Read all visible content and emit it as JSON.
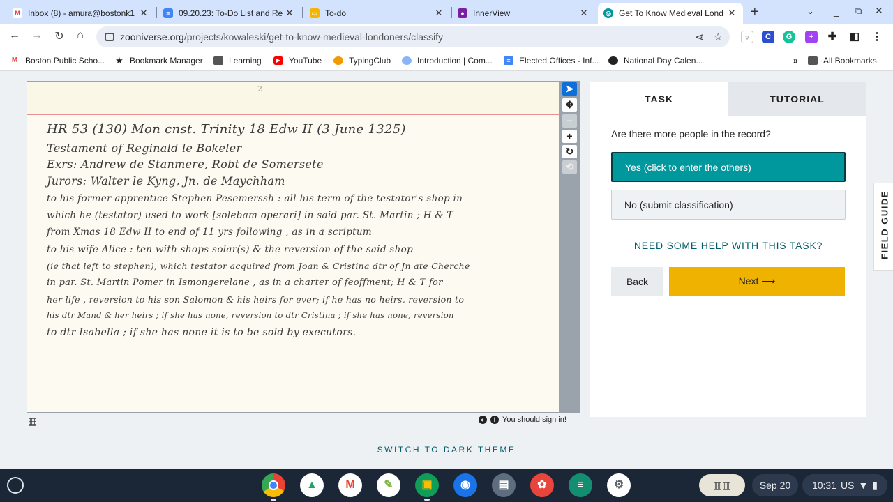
{
  "tabs": [
    {
      "title": "Inbox (8) - amura@bostonk1",
      "icon": "gmail-icon",
      "color": "#ea4335"
    },
    {
      "title": "09.20.23: To-Do List and Re",
      "icon": "docs-icon",
      "color": "#4285f4"
    },
    {
      "title": "To-do",
      "icon": "slides-icon",
      "color": "#f4b400"
    },
    {
      "title": "InnerView",
      "icon": "innerview-icon",
      "color": "#7b1fa2"
    },
    {
      "title": "Get To Know Medieval Lond",
      "icon": "zooniverse-icon",
      "color": "#00979d"
    }
  ],
  "new_tab": "+",
  "address": {
    "host": "zooniverse.org",
    "path": "/projects/kowaleski/get-to-know-medieval-londoners/classify"
  },
  "bookmarks": [
    {
      "label": "Boston Public Scho...",
      "icon": "gmail-icon",
      "color": "#ea4335"
    },
    {
      "label": "Bookmark Manager",
      "icon": "star-icon",
      "color": "#222"
    },
    {
      "label": "Learning",
      "icon": "folder-icon",
      "color": "#555"
    },
    {
      "label": "YouTube",
      "icon": "youtube-icon",
      "color": "#ff0000"
    },
    {
      "label": "TypingClub",
      "icon": "typingclub-icon",
      "color": "#f29900"
    },
    {
      "label": "Introduction | Com...",
      "icon": "globe-icon",
      "color": "#8ab4f8"
    },
    {
      "label": "Elected Offices - Inf...",
      "icon": "docs-icon",
      "color": "#4285f4"
    },
    {
      "label": "National Day Calen...",
      "icon": "globe-icon",
      "color": "#222"
    }
  ],
  "bookmarks_overflow": "»",
  "all_bookmarks": "All Bookmarks",
  "document": {
    "page_mark": "2",
    "lines": [
      "HR 53 (130)    Mon   cnst.  Trinity   18 Edw II    (3 June 1325)",
      "Testament  of   Reginald  le  Bokeler",
      "Exrs:  Andrew  de  Stanmere,  Robt de  Somersete",
      "Jurors:  Walter  le  Kyng,  Jn. de  Maychham",
      "to  his former apprentice  Stephen  Pesemerssh :  all  his  term  of  the  testator's  shop  in",
      "which  he  (testator)  used  to  work  [solebam operari]  in  said  par.  St. Martin ;  H & T",
      "from  Xmas  18 Edw II  to  end  of  11 yrs  following ,   as  in   a  scriptum",
      "to  his  wife  Alice :   ten  with  shops   solar(s)   &  the  reversion  of  the  said  shop",
      "(ie that left to stephen),  which  testator  acquired  from  Joan  &  Cristina  dtr of  Jn ate  Cherche",
      "in  par.  St. Martin  Pomer    in   Ismongerelane ,  as  in  a  charter  of  feoffment;  H & T  for",
      "her  life ,  reversion  to  his  son   Salomon   &  his heirs  for  ever;  if  he has no heirs,  reversion to",
      "his  dtr   Mand  &  her  heirs ;  if she  has  none,  reversion  to   dtr   Cristina ;  if  she  has  none,  reversion",
      "to  dtr  Isabella ;    if  she  has  none    it  is    to  be   sold    by   executors."
    ]
  },
  "viewer_tools": [
    {
      "name": "pointer-tool-button",
      "glyph": "▲",
      "state": "sel"
    },
    {
      "name": "move-tool-button",
      "glyph": "✥",
      "state": ""
    },
    {
      "name": "zoom-out-button",
      "glyph": "−",
      "state": "dis"
    },
    {
      "name": "zoom-in-button",
      "glyph": "+",
      "state": ""
    },
    {
      "name": "rotate-button",
      "glyph": "↻",
      "state": ""
    },
    {
      "name": "reset-button",
      "glyph": "⟲",
      "state": "dis"
    }
  ],
  "sign_in_notice": "You should sign in!",
  "task_panel": {
    "tab_task": "TASK",
    "tab_tutorial": "TUTORIAL",
    "question": "Are there more people in the record?",
    "answers": [
      "Yes (click to enter the others)",
      "No (submit classification)"
    ],
    "help_link": "NEED SOME HELP WITH THIS TASK?",
    "back": "Back",
    "next": "Next ⟶"
  },
  "field_guide": "FIELD GUIDE",
  "dark_theme": "SWITCH TO DARK THEME",
  "shelf": {
    "apps": [
      {
        "name": "chrome-app-icon",
        "color": "#4285f4",
        "glyph": "◉"
      },
      {
        "name": "drive-app-icon",
        "color": "#1fa463",
        "glyph": "▲"
      },
      {
        "name": "gmail-app-icon",
        "color": "#ea4335",
        "glyph": "M"
      },
      {
        "name": "classroom-leaf-app-icon",
        "color": "#7cb342",
        "glyph": "✎"
      },
      {
        "name": "classroom-app-icon",
        "color": "#0f9d58",
        "glyph": "▣"
      },
      {
        "name": "camera-app-icon",
        "color": "#1a73e8",
        "glyph": "●"
      },
      {
        "name": "printer-app-icon",
        "color": "#5f6e7f",
        "glyph": "▤"
      },
      {
        "name": "palette-app-icon",
        "color": "#e8453c",
        "glyph": "✿"
      },
      {
        "name": "forms-app-icon",
        "color": "#138e71",
        "glyph": "≡"
      },
      {
        "name": "settings-app-icon",
        "color": "#5f6368",
        "glyph": "⚙"
      }
    ],
    "date": "Sep 20",
    "time": "10:31",
    "locale": "US"
  }
}
